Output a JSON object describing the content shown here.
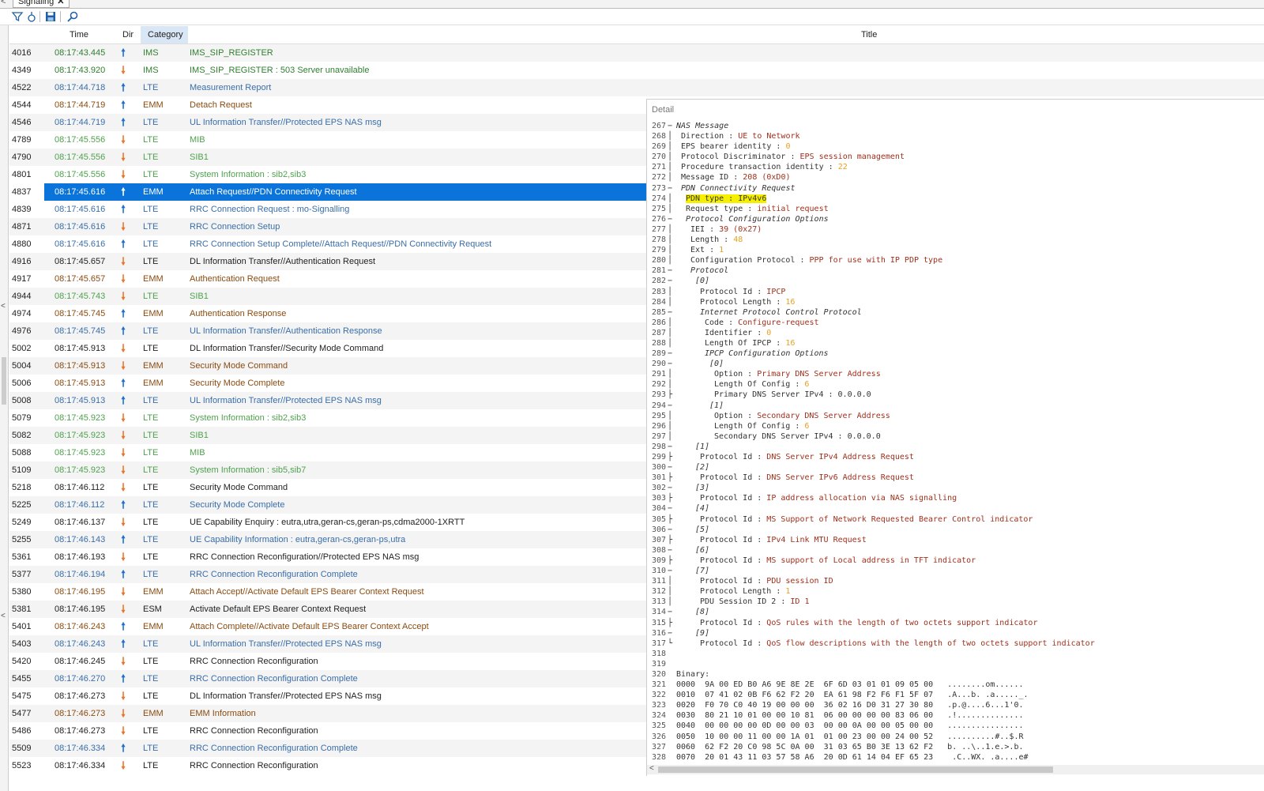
{
  "tab": {
    "label": "Signaling",
    "close": "✕"
  },
  "columns": {
    "time": "Time",
    "dir": "Dir",
    "category": "Category",
    "title": "Title"
  },
  "rows": [
    {
      "no": "4016",
      "time": "08:17:43.445",
      "dir": "up",
      "cat": "IMS",
      "title": "IMS_SIP_REGISTER",
      "color": "ims"
    },
    {
      "no": "4349",
      "time": "08:17:43.920",
      "dir": "down",
      "cat": "IMS",
      "title": "IMS_SIP_REGISTER : 503 Server unavailable",
      "color": "ims"
    },
    {
      "no": "4522",
      "time": "08:17:44.718",
      "dir": "up",
      "cat": "LTE",
      "title": "Measurement Report",
      "color": "lte"
    },
    {
      "no": "4544",
      "time": "08:17:44.719",
      "dir": "up",
      "cat": "EMM",
      "title": "Detach Request",
      "color": "emm"
    },
    {
      "no": "4546",
      "time": "08:17:44.719",
      "dir": "up",
      "cat": "LTE",
      "title": "UL Information Transfer//Protected EPS NAS msg",
      "color": "lte"
    },
    {
      "no": "4789",
      "time": "08:17:45.556",
      "dir": "down",
      "cat": "LTE",
      "title": "MIB",
      "color": "lteg"
    },
    {
      "no": "4790",
      "time": "08:17:45.556",
      "dir": "down",
      "cat": "LTE",
      "title": "SIB1",
      "color": "lteg"
    },
    {
      "no": "4801",
      "time": "08:17:45.556",
      "dir": "down",
      "cat": "LTE",
      "title": "System Information : sib2,sib3",
      "color": "lteg"
    },
    {
      "no": "4837",
      "time": "08:17:45.616",
      "dir": "up",
      "cat": "EMM",
      "title": "Attach Request//PDN Connectivity Request",
      "color": "emm",
      "selected": true
    },
    {
      "no": "4839",
      "time": "08:17:45.616",
      "dir": "up",
      "cat": "LTE",
      "title": "RRC Connection Request : mo-Signalling",
      "color": "lte"
    },
    {
      "no": "4871",
      "time": "08:17:45.616",
      "dir": "down",
      "cat": "LTE",
      "title": "RRC Connection Setup",
      "color": "lte"
    },
    {
      "no": "4880",
      "time": "08:17:45.616",
      "dir": "up",
      "cat": "LTE",
      "title": "RRC Connection Setup Complete//Attach Request//PDN Connectivity Request",
      "color": "lte"
    },
    {
      "no": "4916",
      "time": "08:17:45.657",
      "dir": "down",
      "cat": "LTE",
      "title": "DL Information Transfer//Authentication Request",
      "color": "dark"
    },
    {
      "no": "4917",
      "time": "08:17:45.657",
      "dir": "down",
      "cat": "EMM",
      "title": "Authentication Request",
      "color": "emm"
    },
    {
      "no": "4944",
      "time": "08:17:45.743",
      "dir": "down",
      "cat": "LTE",
      "title": "SIB1",
      "color": "lteg"
    },
    {
      "no": "4974",
      "time": "08:17:45.745",
      "dir": "up",
      "cat": "EMM",
      "title": "Authentication Response",
      "color": "emm"
    },
    {
      "no": "4976",
      "time": "08:17:45.745",
      "dir": "up",
      "cat": "LTE",
      "title": "UL Information Transfer//Authentication Response",
      "color": "lte"
    },
    {
      "no": "5002",
      "time": "08:17:45.913",
      "dir": "down",
      "cat": "LTE",
      "title": "DL Information Transfer//Security Mode Command",
      "color": "dark"
    },
    {
      "no": "5004",
      "time": "08:17:45.913",
      "dir": "down",
      "cat": "EMM",
      "title": "Security Mode Command",
      "color": "emm"
    },
    {
      "no": "5006",
      "time": "08:17:45.913",
      "dir": "up",
      "cat": "EMM",
      "title": "Security Mode Complete",
      "color": "emm"
    },
    {
      "no": "5008",
      "time": "08:17:45.913",
      "dir": "up",
      "cat": "LTE",
      "title": "UL Information Transfer//Protected EPS NAS msg",
      "color": "lte"
    },
    {
      "no": "5079",
      "time": "08:17:45.923",
      "dir": "down",
      "cat": "LTE",
      "title": "System Information : sib2,sib3",
      "color": "lteg"
    },
    {
      "no": "5082",
      "time": "08:17:45.923",
      "dir": "down",
      "cat": "LTE",
      "title": "SIB1",
      "color": "lteg"
    },
    {
      "no": "5088",
      "time": "08:17:45.923",
      "dir": "down",
      "cat": "LTE",
      "title": "MIB",
      "color": "lteg"
    },
    {
      "no": "5109",
      "time": "08:17:45.923",
      "dir": "down",
      "cat": "LTE",
      "title": "System Information : sib5,sib7",
      "color": "lteg"
    },
    {
      "no": "5218",
      "time": "08:17:46.112",
      "dir": "down",
      "cat": "LTE",
      "title": "Security Mode Command",
      "color": "dark"
    },
    {
      "no": "5225",
      "time": "08:17:46.112",
      "dir": "up",
      "cat": "LTE",
      "title": "Security Mode Complete",
      "color": "lte"
    },
    {
      "no": "5249",
      "time": "08:17:46.137",
      "dir": "down",
      "cat": "LTE",
      "title": "UE Capability Enquiry : eutra,utra,geran-cs,geran-ps,cdma2000-1XRTT",
      "color": "dark"
    },
    {
      "no": "5255",
      "time": "08:17:46.143",
      "dir": "up",
      "cat": "LTE",
      "title": "UE Capability Information : eutra,geran-cs,geran-ps,utra",
      "color": "lte"
    },
    {
      "no": "5361",
      "time": "08:17:46.193",
      "dir": "down",
      "cat": "LTE",
      "title": "RRC Connection Reconfiguration//Protected EPS NAS msg",
      "color": "dark"
    },
    {
      "no": "5377",
      "time": "08:17:46.194",
      "dir": "up",
      "cat": "LTE",
      "title": "RRC Connection Reconfiguration Complete",
      "color": "lte"
    },
    {
      "no": "5380",
      "time": "08:17:46.195",
      "dir": "down",
      "cat": "EMM",
      "title": "Attach Accept//Activate Default EPS Bearer Context Request",
      "color": "emm"
    },
    {
      "no": "5381",
      "time": "08:17:46.195",
      "dir": "down",
      "cat": "ESM",
      "title": "Activate Default EPS Bearer Context Request",
      "color": "dark"
    },
    {
      "no": "5401",
      "time": "08:17:46.243",
      "dir": "up",
      "cat": "EMM",
      "title": "Attach Complete//Activate Default EPS Bearer Context Accept",
      "color": "emm"
    },
    {
      "no": "5403",
      "time": "08:17:46.243",
      "dir": "up",
      "cat": "LTE",
      "title": "UL Information Transfer//Protected EPS NAS msg",
      "color": "lte"
    },
    {
      "no": "5420",
      "time": "08:17:46.245",
      "dir": "down",
      "cat": "LTE",
      "title": "RRC Connection Reconfiguration",
      "color": "dark"
    },
    {
      "no": "5455",
      "time": "08:17:46.270",
      "dir": "up",
      "cat": "LTE",
      "title": "RRC Connection Reconfiguration Complete",
      "color": "lte"
    },
    {
      "no": "5475",
      "time": "08:17:46.273",
      "dir": "down",
      "cat": "LTE",
      "title": "DL Information Transfer//Protected EPS NAS msg",
      "color": "dark"
    },
    {
      "no": "5477",
      "time": "08:17:46.273",
      "dir": "down",
      "cat": "EMM",
      "title": "EMM Information",
      "color": "emm"
    },
    {
      "no": "5486",
      "time": "08:17:46.273",
      "dir": "down",
      "cat": "LTE",
      "title": "RRC Connection Reconfiguration",
      "color": "dark"
    },
    {
      "no": "5509",
      "time": "08:17:46.334",
      "dir": "up",
      "cat": "LTE",
      "title": "RRC Connection Reconfiguration Complete",
      "color": "lte"
    },
    {
      "no": "5523",
      "time": "08:17:46.334",
      "dir": "down",
      "cat": "LTE",
      "title": "RRC Connection Reconfiguration",
      "color": "dark"
    }
  ],
  "detail": {
    "title": "Detail",
    "lines": [
      {
        "n": "267",
        "f": "−",
        "i": 0,
        "k": "NAS Message",
        "it": true
      },
      {
        "n": "268",
        "f": "│",
        "i": 1,
        "k": "Direction : ",
        "v": "UE to Network"
      },
      {
        "n": "269",
        "f": "│",
        "i": 1,
        "k": "EPS bearer identity : ",
        "nv": "0"
      },
      {
        "n": "270",
        "f": "│",
        "i": 1,
        "k": "Protocol Discriminator : ",
        "v": "EPS session management"
      },
      {
        "n": "271",
        "f": "│",
        "i": 1,
        "k": "Procedure transaction identity : ",
        "nv": "22"
      },
      {
        "n": "272",
        "f": "│",
        "i": 1,
        "k": "Message ID : ",
        "v": "208 (0xD0)"
      },
      {
        "n": "273",
        "f": "−",
        "i": 1,
        "k": "PDN Connectivity Request",
        "it": true
      },
      {
        "n": "274",
        "f": "│",
        "i": 2,
        "hl": "PDN type : IPv4v6"
      },
      {
        "n": "275",
        "f": "│",
        "i": 2,
        "k": "Request type : ",
        "v": "initial request"
      },
      {
        "n": "276",
        "f": "−",
        "i": 2,
        "k": "Protocol Configuration Options",
        "it": true
      },
      {
        "n": "277",
        "f": "│",
        "i": 3,
        "k": "IEI : ",
        "v": "39 (0x27)"
      },
      {
        "n": "278",
        "f": "│",
        "i": 3,
        "k": "Length : ",
        "nv": "48"
      },
      {
        "n": "279",
        "f": "│",
        "i": 3,
        "k": "Ext : ",
        "nv": "1"
      },
      {
        "n": "280",
        "f": "│",
        "i": 3,
        "k": "Configuration Protocol : ",
        "v": "PPP for use with IP PDP type"
      },
      {
        "n": "281",
        "f": "−",
        "i": 3,
        "k": "Protocol",
        "it": true
      },
      {
        "n": "282",
        "f": "−",
        "i": 4,
        "k": "[0]",
        "it": true
      },
      {
        "n": "283",
        "f": "│",
        "i": 5,
        "k": "Protocol Id : ",
        "v": "IPCP"
      },
      {
        "n": "284",
        "f": "│",
        "i": 5,
        "k": "Protocol Length : ",
        "nv": "16"
      },
      {
        "n": "285",
        "f": "−",
        "i": 5,
        "k": "Internet Protocol Control Protocol",
        "it": true
      },
      {
        "n": "286",
        "f": "│",
        "i": 6,
        "k": "Code : ",
        "v": "Configure-request"
      },
      {
        "n": "287",
        "f": "│",
        "i": 6,
        "k": "Identifier : ",
        "nv": "0"
      },
      {
        "n": "288",
        "f": "│",
        "i": 6,
        "k": "Length Of IPCP : ",
        "nv": "16"
      },
      {
        "n": "289",
        "f": "−",
        "i": 6,
        "k": "IPCP Configuration Options",
        "it": true
      },
      {
        "n": "290",
        "f": "−",
        "i": 7,
        "k": "[0]",
        "it": true
      },
      {
        "n": "291",
        "f": "│",
        "i": 8,
        "k": "Option : ",
        "v": "Primary DNS Server Address"
      },
      {
        "n": "292",
        "f": "│",
        "i": 8,
        "k": "Length Of Config : ",
        "nv": "6"
      },
      {
        "n": "293",
        "f": "├",
        "i": 8,
        "k": "Primary DNS Server IPv4 : 0.0.0.0"
      },
      {
        "n": "294",
        "f": "−",
        "i": 7,
        "k": "[1]",
        "it": true
      },
      {
        "n": "295",
        "f": "│",
        "i": 8,
        "k": "Option : ",
        "v": "Secondary DNS Server Address"
      },
      {
        "n": "296",
        "f": "│",
        "i": 8,
        "k": "Length Of Config : ",
        "nv": "6"
      },
      {
        "n": "297",
        "f": "│",
        "i": 8,
        "k": "Secondary DNS Server IPv4 : 0.0.0.0"
      },
      {
        "n": "298",
        "f": "−",
        "i": 4,
        "k": "[1]",
        "it": true
      },
      {
        "n": "299",
        "f": "├",
        "i": 5,
        "k": "Protocol Id : ",
        "v": "DNS Server IPv4 Address Request"
      },
      {
        "n": "300",
        "f": "−",
        "i": 4,
        "k": "[2]",
        "it": true
      },
      {
        "n": "301",
        "f": "├",
        "i": 5,
        "k": "Protocol Id : ",
        "v": "DNS Server IPv6 Address Request"
      },
      {
        "n": "302",
        "f": "−",
        "i": 4,
        "k": "[3]",
        "it": true
      },
      {
        "n": "303",
        "f": "├",
        "i": 5,
        "k": "Protocol Id : ",
        "v": "IP address allocation via NAS signalling"
      },
      {
        "n": "304",
        "f": "−",
        "i": 4,
        "k": "[4]",
        "it": true
      },
      {
        "n": "305",
        "f": "├",
        "i": 5,
        "k": "Protocol Id : ",
        "v": "MS Support of Network Requested Bearer Control indicator"
      },
      {
        "n": "306",
        "f": "−",
        "i": 4,
        "k": "[5]",
        "it": true
      },
      {
        "n": "307",
        "f": "├",
        "i": 5,
        "k": "Protocol Id : ",
        "v": "IPv4 Link MTU Request"
      },
      {
        "n": "308",
        "f": "−",
        "i": 4,
        "k": "[6]",
        "it": true
      },
      {
        "n": "309",
        "f": "├",
        "i": 5,
        "k": "Protocol Id : ",
        "v": "MS support of Local address in TFT indicator"
      },
      {
        "n": "310",
        "f": "−",
        "i": 4,
        "k": "[7]",
        "it": true
      },
      {
        "n": "311",
        "f": "│",
        "i": 5,
        "k": "Protocol Id : ",
        "v": "PDU session ID"
      },
      {
        "n": "312",
        "f": "│",
        "i": 5,
        "k": "Protocol Length : ",
        "nv": "1"
      },
      {
        "n": "313",
        "f": "│",
        "i": 5,
        "k": "PDU Session ID 2 : ",
        "v": "ID 1"
      },
      {
        "n": "314",
        "f": "−",
        "i": 4,
        "k": "[8]",
        "it": true
      },
      {
        "n": "315",
        "f": "├",
        "i": 5,
        "k": "Protocol Id : ",
        "v": "QoS rules with the length of two octets support indicator"
      },
      {
        "n": "316",
        "f": "−",
        "i": 4,
        "k": "[9]",
        "it": true
      },
      {
        "n": "317",
        "f": "└",
        "i": 5,
        "k": "Protocol Id : ",
        "v": "QoS flow descriptions with the length of two octets support indicator"
      },
      {
        "n": "318",
        "f": "",
        "i": 0,
        "k": ""
      },
      {
        "n": "319",
        "f": "",
        "i": 0,
        "k": ""
      },
      {
        "n": "320",
        "f": "",
        "i": 0,
        "k": "Binary:"
      },
      {
        "n": "321",
        "f": "",
        "i": 0,
        "k": "0000  9A 00 ED B0 A6 9E 8E 2E  6F 6D 03 01 01 09 05 00   ........om......"
      },
      {
        "n": "322",
        "f": "",
        "i": 0,
        "k": "0010  07 41 02 0B F6 62 F2 20  EA 61 98 F2 F6 F1 5F 07   .A...b. .a....._."
      },
      {
        "n": "323",
        "f": "",
        "i": 0,
        "k": "0020  F0 70 C0 40 19 00 00 00  36 02 16 D0 31 27 30 80   .p.@....6...1'0."
      },
      {
        "n": "324",
        "f": "",
        "i": 0,
        "k": "0030  80 21 10 01 00 00 10 81  06 00 00 00 00 83 06 00   .!.............."
      },
      {
        "n": "325",
        "f": "",
        "i": 0,
        "k": "0040  00 00 00 00 0D 00 00 03  00 00 0A 00 00 05 00 00   ................"
      },
      {
        "n": "326",
        "f": "",
        "i": 0,
        "k": "0050  10 00 00 11 00 00 1A 01  01 00 23 00 00 24 00 52   ..........#..$.R"
      },
      {
        "n": "327",
        "f": "",
        "i": 0,
        "k": "0060  62 F2 20 C0 98 5C 0A 00  31 03 65 B0 3E 13 62 F2   b. ..\\..1.e.>.b."
      },
      {
        "n": "328",
        "f": "",
        "i": 0,
        "k": "0070  20 01 43 11 03 57 58 A6  20 0D 61 14 04 EF 65 23    .C..WX. .a....e#"
      }
    ]
  }
}
